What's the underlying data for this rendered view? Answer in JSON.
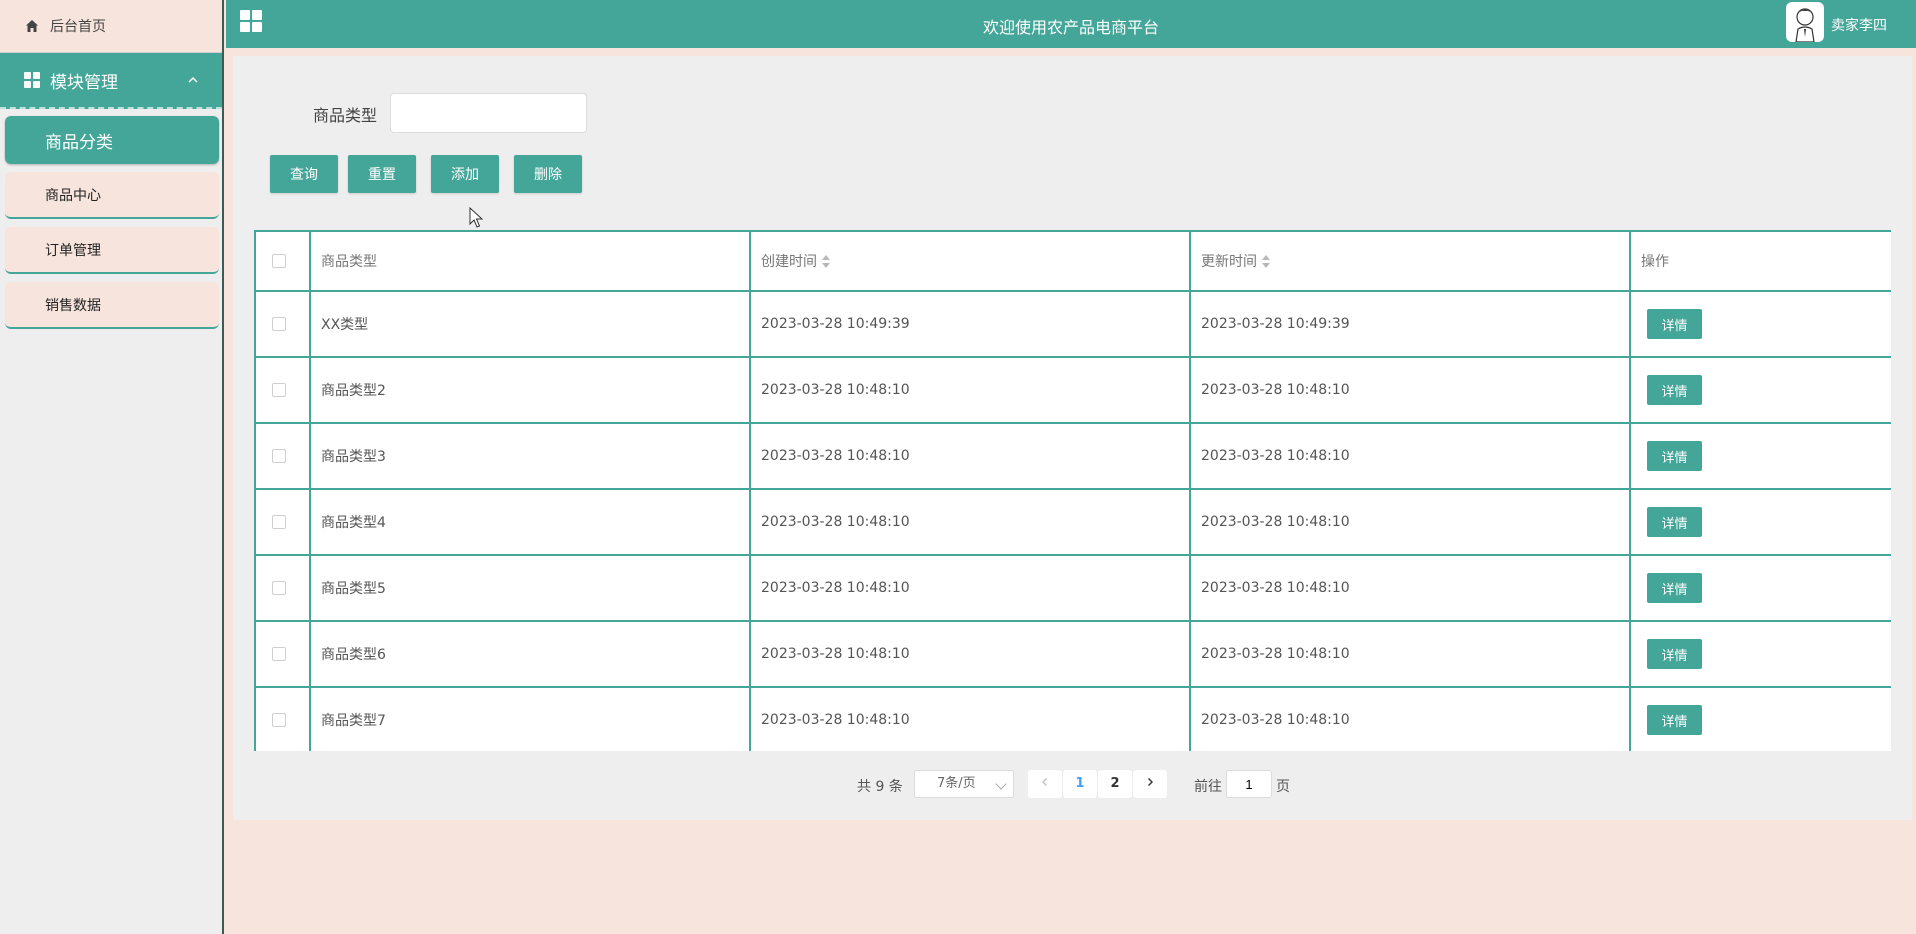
{
  "sidebar": {
    "home": "后台首页",
    "module": "模块管理",
    "items": [
      "商品分类",
      "商品中心",
      "订单管理",
      "销售数据"
    ],
    "active_index": 0
  },
  "header": {
    "title": "欢迎使用农产品电商平台",
    "user": "卖家李四"
  },
  "filter": {
    "label": "商品类型",
    "value": "",
    "placeholder": ""
  },
  "toolbar": {
    "query": "查询",
    "reset": "重置",
    "add": "添加",
    "delete": "删除"
  },
  "table": {
    "headers": [
      "商品类型",
      "创建时间",
      "更新时间",
      "操作"
    ],
    "action_label": "详情",
    "rows": [
      {
        "type": "XX类型",
        "created": "2023-03-28 10:49:39",
        "updated": "2023-03-28 10:49:39"
      },
      {
        "type": "商品类型2",
        "created": "2023-03-28 10:48:10",
        "updated": "2023-03-28 10:48:10"
      },
      {
        "type": "商品类型3",
        "created": "2023-03-28 10:48:10",
        "updated": "2023-03-28 10:48:10"
      },
      {
        "type": "商品类型4",
        "created": "2023-03-28 10:48:10",
        "updated": "2023-03-28 10:48:10"
      },
      {
        "type": "商品类型5",
        "created": "2023-03-28 10:48:10",
        "updated": "2023-03-28 10:48:10"
      },
      {
        "type": "商品类型6",
        "created": "2023-03-28 10:48:10",
        "updated": "2023-03-28 10:48:10"
      },
      {
        "type": "商品类型7",
        "created": "2023-03-28 10:48:10",
        "updated": "2023-03-28 10:48:10"
      }
    ]
  },
  "pagination": {
    "total": "共 9 条",
    "page_size": "7条/页",
    "pages": [
      "1",
      "2"
    ],
    "current": "1",
    "goto": "前往",
    "jump_value": "1",
    "unit": "页"
  },
  "colors": {
    "accent": "#44a699",
    "background": "#f7e4dc",
    "panel": "#eeeeee",
    "link_active": "#409eff"
  }
}
